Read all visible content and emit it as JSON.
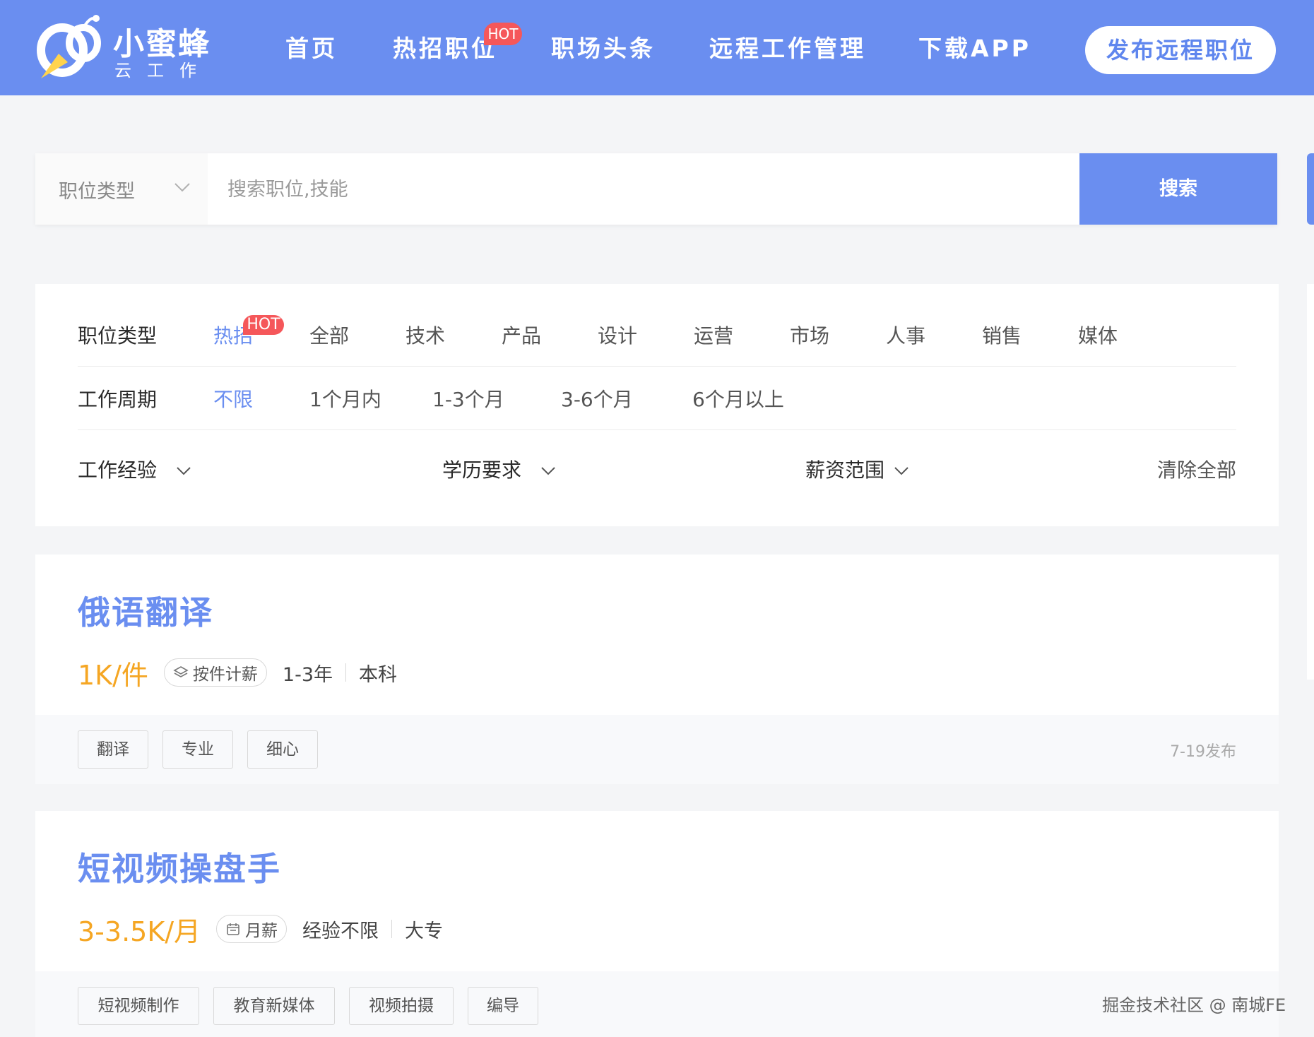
{
  "brand": {
    "name": "小蜜蜂",
    "sub": "云工作"
  },
  "nav": {
    "items": [
      {
        "label": "首页"
      },
      {
        "label": "热招职位"
      },
      {
        "label": "职场头条"
      },
      {
        "label": "远程工作管理"
      },
      {
        "label": "下载APP"
      }
    ],
    "hot_badge": "HOT",
    "publish_label": "发布远程职位"
  },
  "search": {
    "type_label": "职位类型",
    "placeholder": "搜索职位,技能",
    "value": "",
    "button_label": "搜索"
  },
  "filters": {
    "job_type": {
      "label": "职位类型",
      "hot_badge": "HOT",
      "options": [
        "热招",
        "全部",
        "技术",
        "产品",
        "设计",
        "运营",
        "市场",
        "人事",
        "销售",
        "媒体"
      ],
      "selected": "热招"
    },
    "period": {
      "label": "工作周期",
      "options": [
        "不限",
        "1个月内",
        "1-3个月",
        "3-6个月",
        "6个月以上"
      ],
      "selected": "不限"
    },
    "dropdowns": {
      "experience": "工作经验",
      "education": "学历要求",
      "salary": "薪资范围"
    },
    "clear_label": "清除全部"
  },
  "jobs": [
    {
      "title": "俄语翻译",
      "salary": "1K/件",
      "pay_type": "按件计薪",
      "pay_icon": "layers-icon",
      "experience": "1-3年",
      "education": "本科",
      "tags": [
        "翻译",
        "专业",
        "细心"
      ],
      "posted": "7-19发布"
    },
    {
      "title": "短视频操盘手",
      "salary": "3-3.5K/月",
      "pay_type": "月薪",
      "pay_icon": "calendar-icon",
      "experience": "经验不限",
      "education": "大专",
      "tags": [
        "短视频制作",
        "教育新媒体",
        "视频拍摄",
        "编导"
      ]
    }
  ],
  "watermark": "掘金技术社区 @ 南城FE",
  "colors": {
    "primary": "#6a8ef0",
    "accent": "#f5a623",
    "hot": "#f5575a"
  }
}
